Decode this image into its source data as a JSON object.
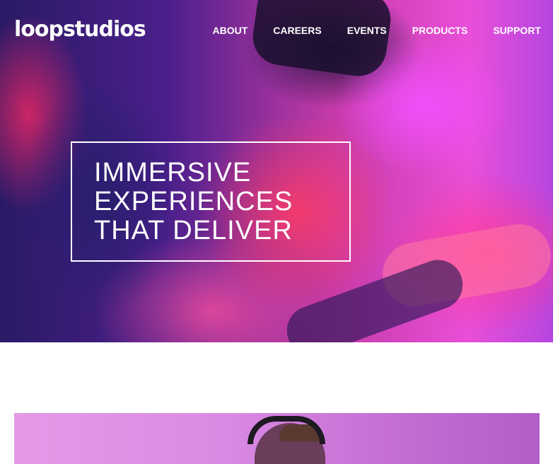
{
  "header": {
    "logo": "loopstudios",
    "nav": [
      "ABOUT",
      "CAREERS",
      "EVENTS",
      "PRODUCTS",
      "SUPPORT"
    ]
  },
  "hero": {
    "headline_lines": [
      "IMMERSIVE",
      "EXPERIENCES",
      "THAT DELIVER"
    ]
  },
  "colors": {
    "text": "#ffffff",
    "page_background": "#ffffff",
    "hero_pink": "#e94fd8",
    "hero_purple": "#4a1f8a"
  }
}
